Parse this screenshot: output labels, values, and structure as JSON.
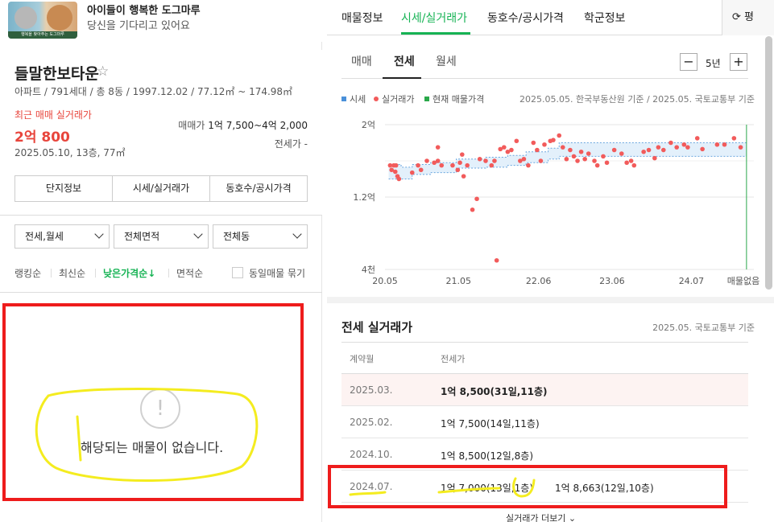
{
  "ad": {
    "title": "아이들이 행복한 도그마루",
    "subtitle": "당신을 기다리고 있어요",
    "image_caption": "행복을 찾아주는 도그마루"
  },
  "complex": {
    "name": "들말한보타운",
    "star_icon": "☆",
    "info": "아파트 / 791세대 / 총 8동 / 1997.12.02 / 77.12㎡ ~ 174.98㎡",
    "recent_label": "최근 매매 실거래가",
    "recent_price": "2억 800",
    "recent_detail": "2025.05.10, 13층, 77㎡",
    "sale_label": "매매가",
    "sale_range": "1억 7,500~4억 2,000",
    "jeonse_range": "전세가 -",
    "tabs": [
      "단지정보",
      "시세/실거래가",
      "동호수/공시가격"
    ]
  },
  "filters": {
    "trade_type": "전세,월세",
    "area": "전체면적",
    "dong": "전체동"
  },
  "sort": {
    "items": [
      "랭킹순",
      "최신순",
      "낮은가격순↓",
      "면적순"
    ],
    "same_listing": "동일매물 묶기"
  },
  "empty": {
    "icon": "!",
    "message": "해당되는 매물이 없습니다."
  },
  "top_tabs": [
    "매물정보",
    "시세/실거래가",
    "동호수/공시가격",
    "학군정보"
  ],
  "refresh_label": "⟳ 평",
  "sub_tabs": [
    "매매",
    "전세",
    "월세"
  ],
  "zoom": {
    "minus": "−",
    "value": "5년",
    "plus": "+"
  },
  "legend": {
    "items": [
      {
        "label": "시세",
        "color": "#4a90d9"
      },
      {
        "label": "실거래가",
        "color": "#f25b5b"
      },
      {
        "label": "현재 매물가격",
        "color": "#2aa84a"
      }
    ],
    "source": "2025.05.05. 한국부동산원 기준 / 2025.05. 국토교통부 기준"
  },
  "chart_data": {
    "type": "scatter",
    "y_tick_labels": [
      "2억",
      "1.2억",
      "4천"
    ],
    "x_tick_labels": [
      "20.05",
      "21.05",
      "22.06",
      "23.06",
      "24.07"
    ],
    "end_label": "매물없음",
    "ylim": [
      0.4,
      2.0
    ],
    "y_unit": "억",
    "x_unit": "year",
    "x_range": [
      2020.33,
      2025.35
    ],
    "real_trades": [
      [
        2020.4,
        1.55
      ],
      [
        2020.42,
        1.5
      ],
      [
        2020.45,
        1.55
      ],
      [
        2020.47,
        1.48
      ],
      [
        2020.48,
        1.55
      ],
      [
        2020.5,
        1.43
      ],
      [
        2020.52,
        1.4
      ],
      [
        2020.7,
        1.47
      ],
      [
        2020.78,
        1.55
      ],
      [
        2020.82,
        1.5
      ],
      [
        2020.9,
        1.6
      ],
      [
        2021.0,
        1.58
      ],
      [
        2021.05,
        1.75
      ],
      [
        2021.05,
        1.6
      ],
      [
        2021.1,
        1.55
      ],
      [
        2021.25,
        1.55
      ],
      [
        2021.32,
        1.5
      ],
      [
        2021.35,
        1.58
      ],
      [
        2021.38,
        1.67
      ],
      [
        2021.4,
        1.43
      ],
      [
        2021.45,
        1.55
      ],
      [
        2021.52,
        1.06
      ],
      [
        2021.58,
        1.18
      ],
      [
        2021.62,
        1.62
      ],
      [
        2021.7,
        1.6
      ],
      [
        2021.78,
        1.55
      ],
      [
        2021.82,
        1.6
      ],
      [
        2021.85,
        0.5
      ],
      [
        2021.9,
        1.73
      ],
      [
        2021.95,
        1.75
      ],
      [
        2022.0,
        1.7
      ],
      [
        2022.05,
        1.72
      ],
      [
        2022.12,
        1.82
      ],
      [
        2022.17,
        1.6
      ],
      [
        2022.22,
        1.62
      ],
      [
        2022.28,
        1.55
      ],
      [
        2022.35,
        1.8
      ],
      [
        2022.4,
        1.72
      ],
      [
        2022.45,
        1.6
      ],
      [
        2022.5,
        1.78
      ],
      [
        2022.58,
        1.82
      ],
      [
        2022.62,
        1.83
      ],
      [
        2022.7,
        1.88
      ],
      [
        2022.75,
        1.75
      ],
      [
        2022.8,
        1.62
      ],
      [
        2022.85,
        1.72
      ],
      [
        2022.9,
        1.65
      ],
      [
        2022.95,
        1.6
      ],
      [
        2023.0,
        1.7
      ],
      [
        2023.05,
        1.62
      ],
      [
        2023.1,
        1.68
      ],
      [
        2023.18,
        1.6
      ],
      [
        2023.22,
        1.55
      ],
      [
        2023.3,
        1.65
      ],
      [
        2023.35,
        1.58
      ],
      [
        2023.45,
        1.72
      ],
      [
        2023.55,
        1.68
      ],
      [
        2023.62,
        1.58
      ],
      [
        2023.68,
        1.6
      ],
      [
        2023.72,
        1.55
      ],
      [
        2023.85,
        1.7
      ],
      [
        2023.92,
        1.72
      ],
      [
        2024.0,
        1.63
      ],
      [
        2024.05,
        1.75
      ],
      [
        2024.12,
        1.72
      ],
      [
        2024.22,
        1.8
      ],
      [
        2024.3,
        1.75
      ],
      [
        2024.4,
        1.78
      ],
      [
        2024.45,
        1.75
      ],
      [
        2024.58,
        1.85
      ],
      [
        2024.65,
        1.73
      ],
      [
        2024.85,
        1.78
      ],
      [
        2024.95,
        1.78
      ],
      [
        2025.08,
        1.85
      ],
      [
        2025.17,
        1.75
      ]
    ],
    "market_band": {
      "x": [
        2020.38,
        2020.55,
        2020.7,
        2020.95,
        2021.3,
        2021.7,
        2022.0,
        2022.25,
        2022.55,
        2022.7,
        2023.0,
        2023.5,
        2024.0,
        2024.5,
        2025.0,
        2025.25
      ],
      "upper": [
        1.56,
        1.53,
        1.56,
        1.58,
        1.62,
        1.64,
        1.66,
        1.7,
        1.74,
        1.8,
        1.8,
        1.8,
        1.8,
        1.8,
        1.8,
        1.8
      ],
      "lower": [
        1.4,
        1.4,
        1.45,
        1.47,
        1.52,
        1.53,
        1.55,
        1.58,
        1.62,
        1.65,
        1.65,
        1.65,
        1.65,
        1.65,
        1.65,
        1.65
      ]
    },
    "current_marker_x": 2025.25
  },
  "table": {
    "title": "전세 실거래가",
    "source": "2025.05. 국토교통부 기준",
    "headers": [
      "계약월",
      "전세가"
    ],
    "rows": [
      {
        "date": "2025.03.",
        "price": "1억 8,500(31일,11층)",
        "price2": ""
      },
      {
        "date": "2025.02.",
        "price": "1억 7,500(14일,11층)",
        "price2": ""
      },
      {
        "date": "2024.10.",
        "price": "1억 8,500(12일,8층)",
        "price2": ""
      },
      {
        "date": "2024.07.",
        "price": "1억 7,000(13일,1층)",
        "price2": "1억 8,663(12일,10층)"
      }
    ],
    "more": "실거래가 더보기 ⌄"
  }
}
